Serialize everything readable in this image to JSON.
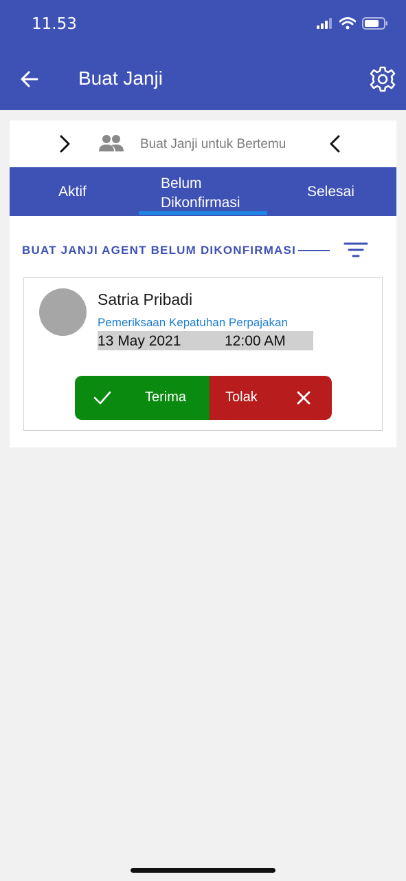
{
  "status_bar": {
    "time": "11.53"
  },
  "header": {
    "title": "Buat Janji"
  },
  "switcher": {
    "label": "Buat Janji untuk Bertemu"
  },
  "tabs": [
    {
      "label": "Aktif"
    },
    {
      "label": "Belum Dikonfirmasi",
      "line1": "Belum",
      "line2": "Dikonfirmasi",
      "selected": true
    },
    {
      "label": "Selesai"
    }
  ],
  "section": {
    "title": "BUAT JANJI AGENT BELUM DIKONFIRMASI"
  },
  "appointment": {
    "name": "Satria Pribadi",
    "service": "Pemeriksaan Kepatuhan Perpajakan",
    "date": "13 May 2021",
    "time": "12:00 AM",
    "accept_label": "Terima",
    "reject_label": "Tolak"
  },
  "colors": {
    "primary": "#3e51b5",
    "accept": "#0a8a0f",
    "reject": "#b81c1c",
    "link": "#1e7fd0",
    "tab_indicator": "#1e88e5"
  },
  "icons": [
    "back-arrow-icon",
    "gear-icon",
    "chevron-right-icon",
    "people-icon",
    "chevron-left-icon",
    "filter-icon",
    "check-icon",
    "close-icon",
    "signal-icon",
    "wifi-icon",
    "battery-icon"
  ]
}
